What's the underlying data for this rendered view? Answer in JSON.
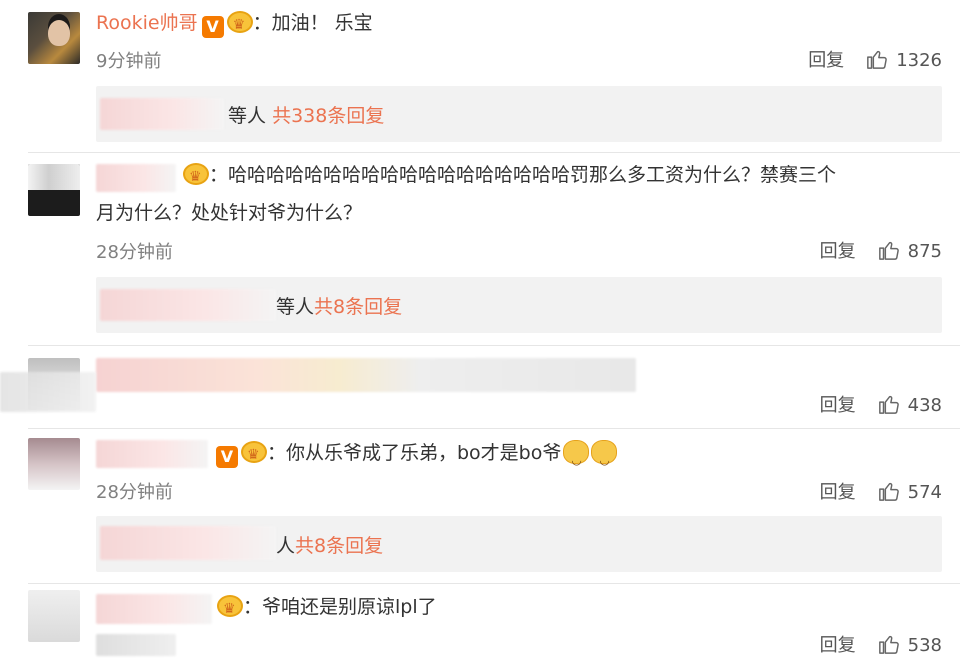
{
  "comments": [
    {
      "username": "Rookie帅哥",
      "text": "：加油！ 乐宝",
      "time": "9分钟前",
      "reply_label": "回复",
      "likes": "1326",
      "replies_prefix": "等人",
      "replies_link": "共338条回复"
    },
    {
      "text_line1": "：哈哈哈哈哈哈哈哈哈哈哈哈哈哈哈哈哈哈罚那么多工资为什么？禁赛三个",
      "text_line2": "月为什么？处处针对爷为什么？",
      "time": "28分钟前",
      "reply_label": "回复",
      "likes": "875",
      "replies_prefix": "等人",
      "replies_link": "共8条回复"
    },
    {
      "reply_label": "回复",
      "likes": "438"
    },
    {
      "text": "：你从乐爷成了乐弟，bo才是bo爷",
      "time": "28分钟前",
      "reply_label": "回复",
      "likes": "574",
      "replies_prefix": "人",
      "replies_link": "共8条回复"
    },
    {
      "text": "：爷咱还是别原谅lpl了",
      "reply_label": "回复",
      "likes": "538"
    }
  ],
  "colors": {
    "accent": "#eb7350",
    "reply_bg": "#f2f2f2",
    "meta": "#808080"
  },
  "icons": [
    "verified-v-icon",
    "crown-badge-icon",
    "thumb-up-icon",
    "doge-emoji-icon"
  ]
}
